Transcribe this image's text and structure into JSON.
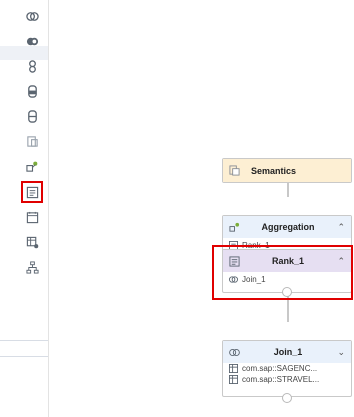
{
  "palette": {
    "tools": [
      {
        "icon": "union-icon"
      },
      {
        "icon": "intersect-icon"
      },
      {
        "icon": "join-stack-icon"
      },
      {
        "icon": "database-icon"
      },
      {
        "icon": "minus-icon"
      },
      {
        "icon": "view-icon"
      },
      {
        "icon": "aggregation-icon"
      },
      {
        "icon": "rank-icon"
      },
      {
        "icon": "calendar-icon"
      },
      {
        "icon": "table-function-icon"
      },
      {
        "icon": "hierarchy-icon"
      }
    ],
    "selected_tool": "rank-icon",
    "highlight_color": "#e00000"
  },
  "canvas": {
    "nodes": {
      "semantics": {
        "title": "Semantics",
        "color": "#fdefd3"
      },
      "aggregation": {
        "title": "Aggregation",
        "color": "#e9f1fb",
        "input": "Rank_1"
      },
      "rank": {
        "title": "Rank_1",
        "color": "#e6dff2",
        "input": "Join_1"
      },
      "join": {
        "title": "Join_1",
        "color": "#e9f1fb",
        "inputs": [
          "com.sap::SAGENC...",
          "com.sap::STRAVEL..."
        ]
      }
    }
  }
}
